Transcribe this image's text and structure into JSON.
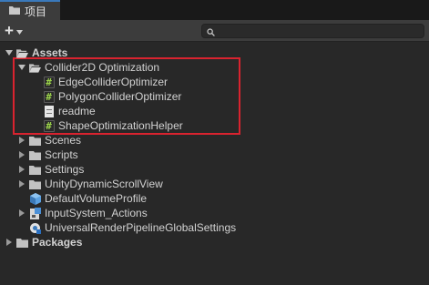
{
  "tab": {
    "label": "项目",
    "icon": "folder-icon"
  },
  "toolbar": {
    "add_label": "+",
    "search": {
      "value": "",
      "placeholder": ""
    }
  },
  "tree": {
    "assets": "Assets",
    "collider_folder": "Collider2D Optimization",
    "files": [
      {
        "label": "EdgeColliderOptimizer",
        "icon": "csharp-script-icon"
      },
      {
        "label": "PolygonColliderOptimizer",
        "icon": "csharp-script-icon"
      },
      {
        "label": "readme",
        "icon": "text-document-icon"
      },
      {
        "label": "ShapeOptimizationHelper",
        "icon": "csharp-script-icon"
      }
    ],
    "scenes": "Scenes",
    "scripts": "Scripts",
    "settings": "Settings",
    "unity_dynamic_scroll_view": "UnityDynamicScrollView",
    "default_volume_profile": "DefaultVolumeProfile",
    "input_system_actions": "InputSystem_Actions",
    "urp_global_settings": "UniversalRenderPipelineGlobalSettings",
    "packages": "Packages"
  },
  "colors": {
    "accent": "#3a79bb",
    "highlight": "#d9232f",
    "folder": "#c2c2c2"
  }
}
